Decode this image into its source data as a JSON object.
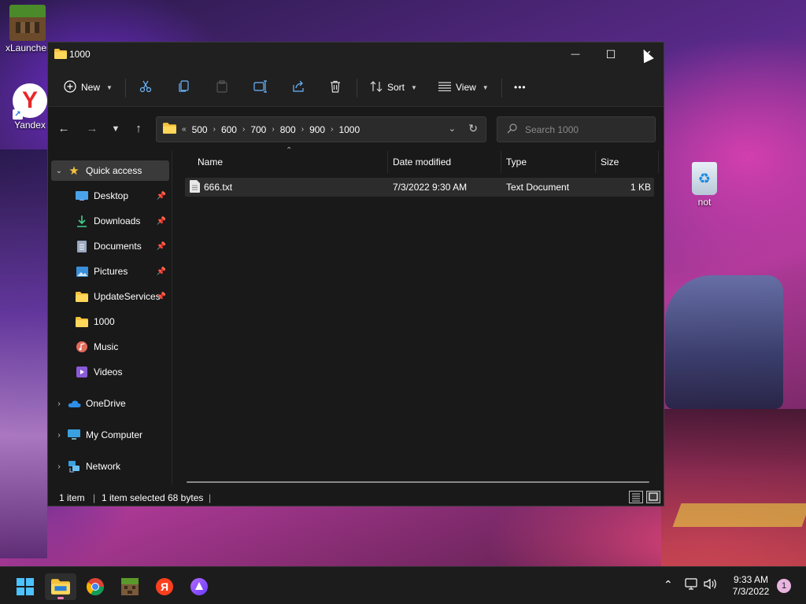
{
  "desktop": {
    "icons": [
      {
        "label": "xLauncher",
        "icon": "xlauncher-icon"
      },
      {
        "label": "Yandex",
        "icon": "yandex-browser-icon"
      },
      {
        "label": "not",
        "icon": "recycle-bin-icon"
      }
    ]
  },
  "window": {
    "title": "1000",
    "controls": {
      "minimize": "—",
      "maximize": "☐",
      "close": "✕"
    },
    "toolbar": {
      "new_label": "New",
      "sort_label": "Sort",
      "view_label": "View",
      "more_label": "•••",
      "icons": [
        "cut-icon",
        "copy-icon",
        "paste-icon",
        "rename-icon",
        "share-icon",
        "delete-icon"
      ]
    },
    "address": {
      "overflow": "«",
      "crumbs": [
        "500",
        "600",
        "700",
        "800",
        "900",
        "1000"
      ]
    },
    "search": {
      "placeholder": "Search 1000"
    },
    "sidebar": {
      "items": [
        {
          "label": "Quick access",
          "icon": "star-icon"
        },
        {
          "label": "Desktop",
          "icon": "desktop-icon"
        },
        {
          "label": "Downloads",
          "icon": "downloads-icon"
        },
        {
          "label": "Documents",
          "icon": "documents-icon"
        },
        {
          "label": "Pictures",
          "icon": "pictures-icon"
        },
        {
          "label": "UpdateServices",
          "icon": "folder-icon"
        },
        {
          "label": "1000",
          "icon": "folder-icon"
        },
        {
          "label": "Music",
          "icon": "music-icon"
        },
        {
          "label": "Videos",
          "icon": "videos-icon"
        },
        {
          "label": "OneDrive",
          "icon": "onedrive-icon"
        },
        {
          "label": "My Computer",
          "icon": "computer-icon"
        },
        {
          "label": "Network",
          "icon": "network-icon"
        }
      ]
    },
    "columns": [
      "Name",
      "Date modified",
      "Type",
      "Size"
    ],
    "files": [
      {
        "name": "666.txt",
        "date": "7/3/2022 9:30 AM",
        "type": "Text Document",
        "size": "1 KB"
      }
    ],
    "status": {
      "count": "1 item",
      "selected": "1 item selected",
      "bytes": "68 bytes"
    }
  },
  "taskbar": {
    "apps": [
      "start-icon",
      "file-explorer-icon",
      "chrome-icon",
      "minecraft-icon",
      "yandex-icon",
      "alice-icon"
    ],
    "time": "9:33 AM",
    "date": "7/3/2022",
    "notifications": "1",
    "colors": {
      "accent": "#ff7ab6"
    }
  }
}
